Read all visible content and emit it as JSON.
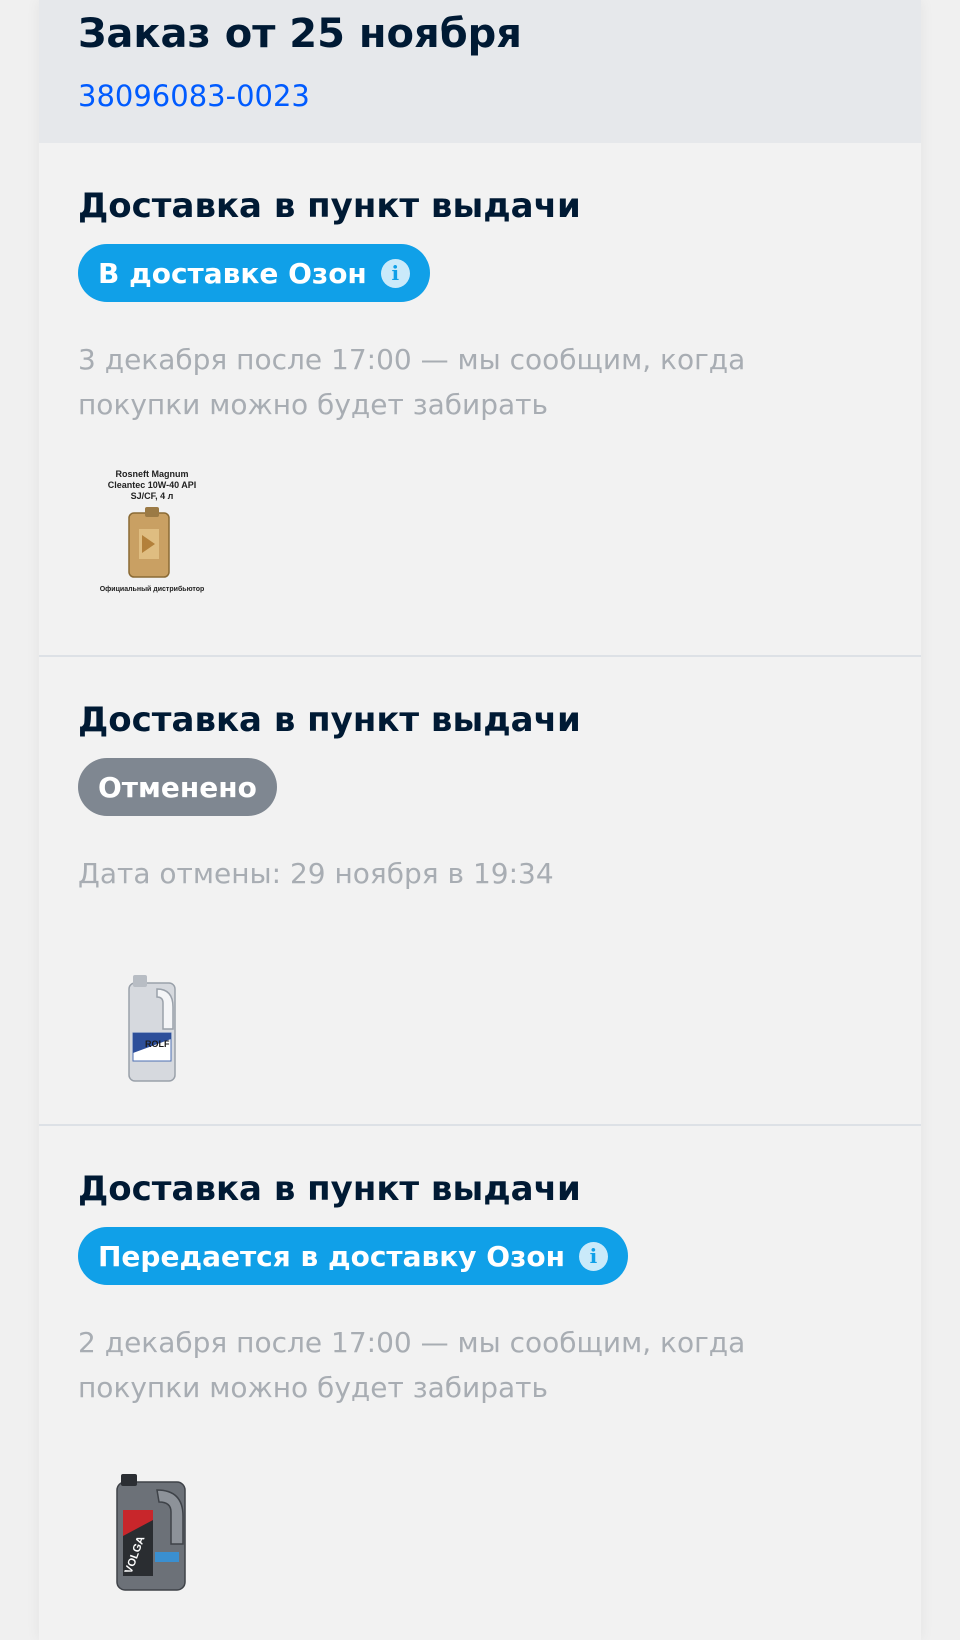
{
  "order": {
    "title": "Заказ от 25 ноября",
    "number": "38096083-0023"
  },
  "colors": {
    "pill_blue": "#10a0e8",
    "pill_gray": "#7f8791",
    "link_blue": "#005bff",
    "title_dark": "#001a34",
    "muted_text": "#a8adb3"
  },
  "shipments": [
    {
      "title": "Доставка в пункт выдачи",
      "status": "В доставке Озон",
      "status_has_info": true,
      "description": "3 декабря после 17:00 — мы сообщим, когда покупки можно будет забирать",
      "product_image_icon": "oil-canister-gold-icon",
      "product_image_text": {
        "caption_top": "Rosneft Magnum Cleantec 10W-40 API SJ/CF, 4 л",
        "caption_bottom": "Официальный дистрибьютор"
      }
    },
    {
      "title": "Доставка в пункт выдачи",
      "status": "Отменено",
      "status_has_info": false,
      "description": "Дата отмены: 29 ноября в 19:34",
      "product_image_icon": "oil-canister-silver-icon",
      "product_image_text": {
        "brand": "ROLF"
      }
    },
    {
      "title": "Доставка в пункт выдачи",
      "status": "Передается в доставку Озон",
      "status_has_info": true,
      "description": "2 декабря после 17:00 — мы сообщим, когда покупки можно будет забирать",
      "product_image_icon": "oil-canister-gray-icon",
      "product_image_text": {
        "brand": "VOLGA"
      }
    }
  ]
}
